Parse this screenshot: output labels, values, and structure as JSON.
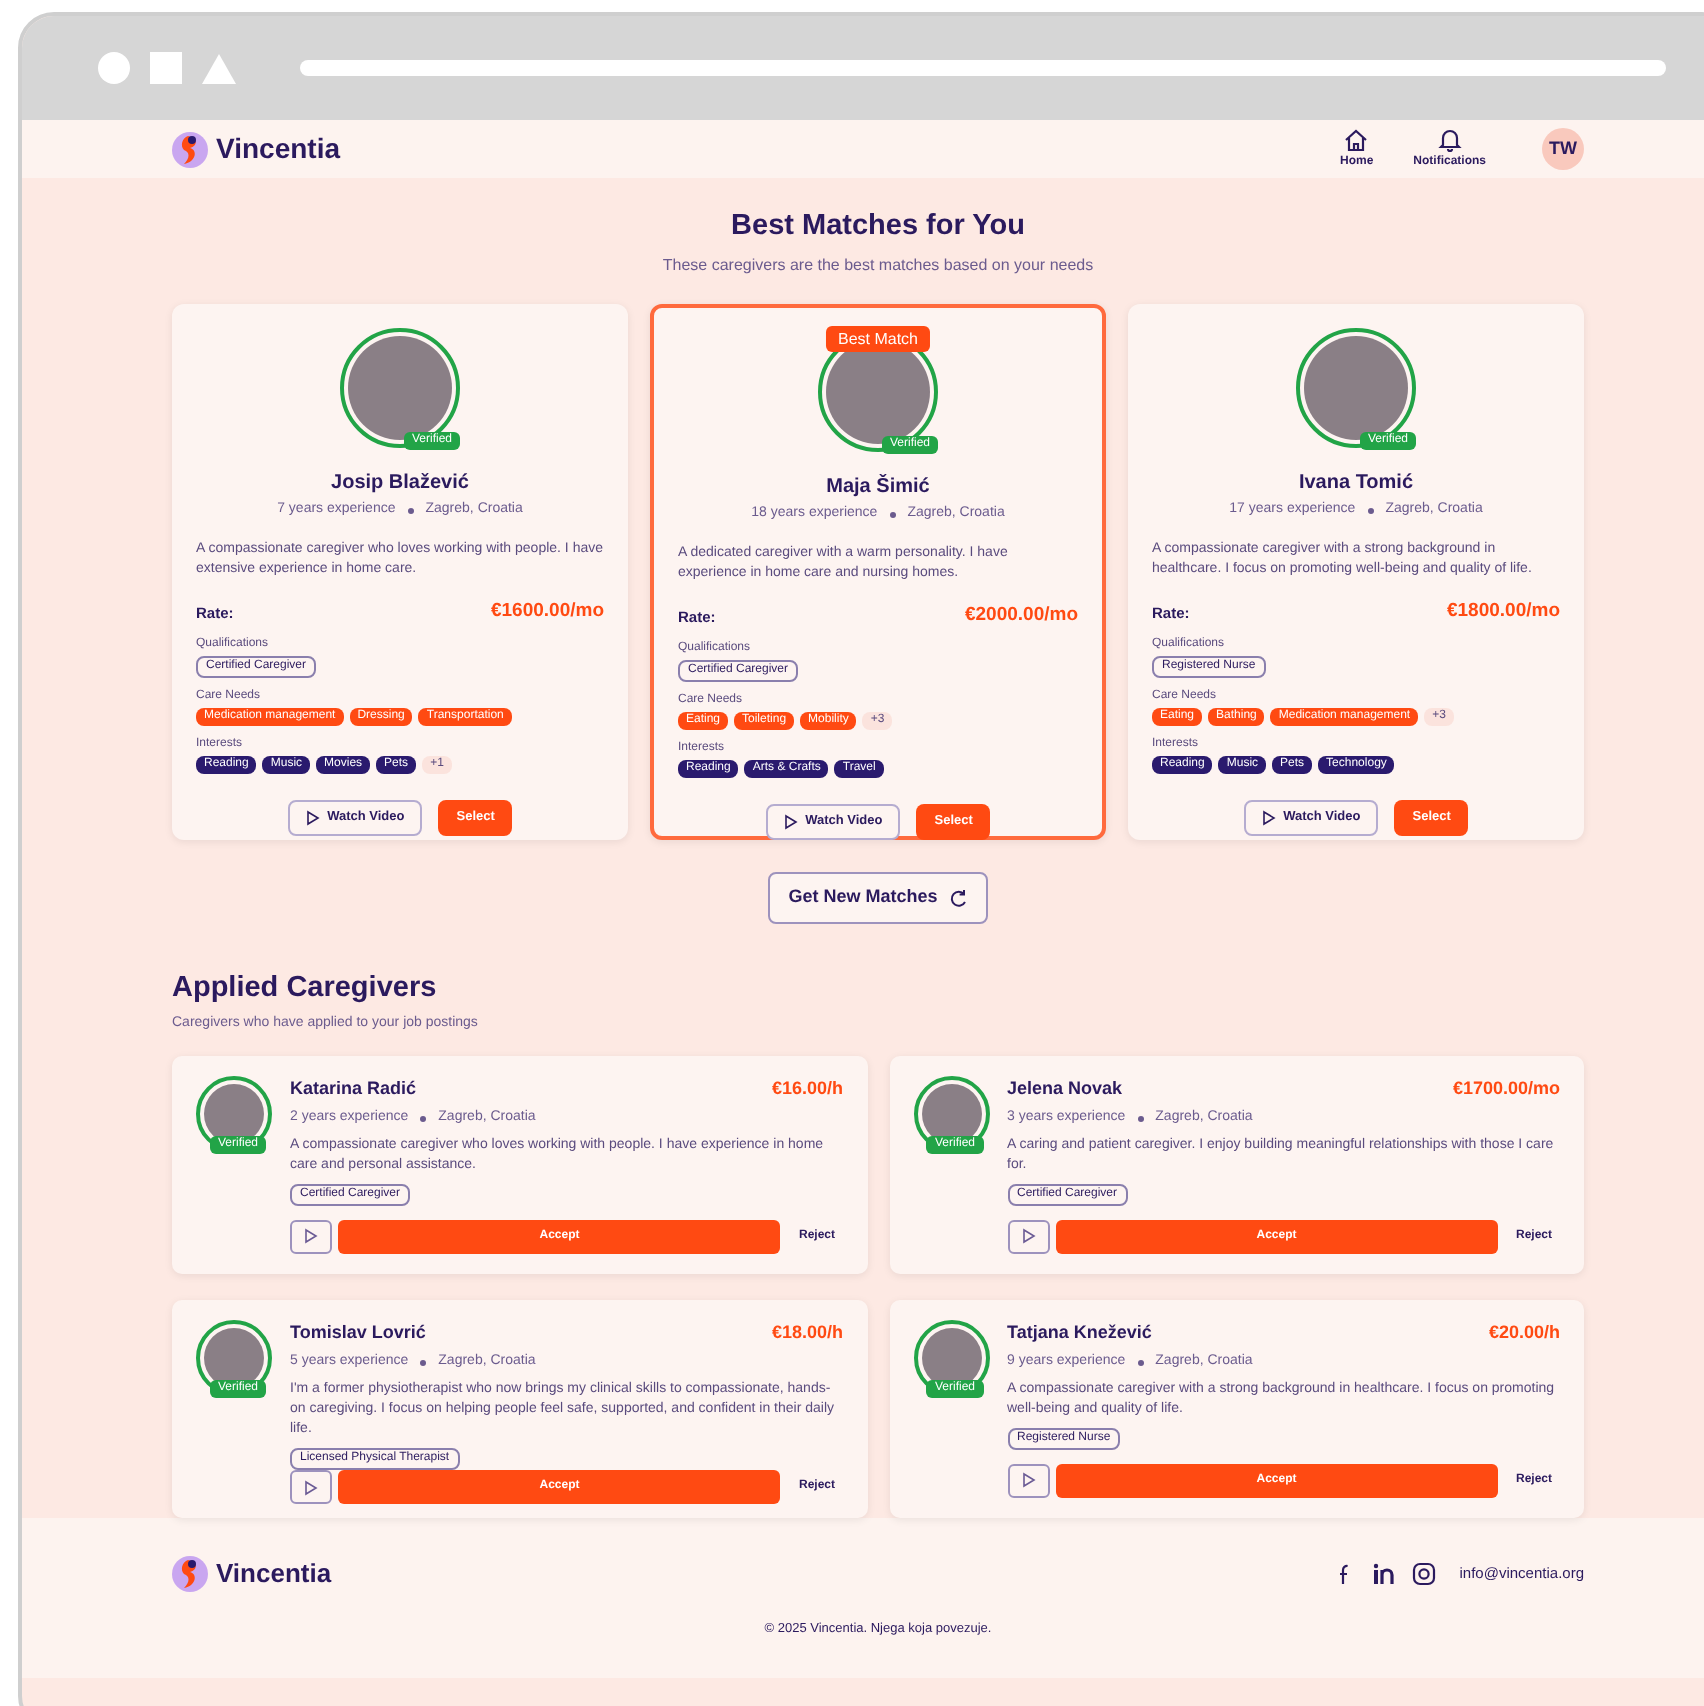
{
  "header": {
    "brand": "Vincentia",
    "nav": [
      {
        "label": "Home"
      },
      {
        "label": "Notifications"
      }
    ],
    "avatar": "TW"
  },
  "matches": {
    "title": "Best Matches for You",
    "subtitle": "These caregivers are the best matches based on your needs",
    "cards": [
      {
        "name": "Josip Blažević",
        "experience": "7 years experience",
        "location": "Zagreb, Croatia",
        "verified": "Verified",
        "featured": false,
        "bio": "A compassionate caregiver who loves working with people. I have extensive experience in home care.",
        "rate_label": "Rate:",
        "rate": "€1600.00/mo",
        "qualifications_label": "Qualifications",
        "qualifications": [
          "Certified Caregiver"
        ],
        "care_needs_label": "Care Needs",
        "care_needs": [
          "Medication management",
          "Dressing",
          "Transportation"
        ],
        "interests_label": "Interests",
        "interests": [
          "Reading",
          "Music",
          "Movies",
          "Pets"
        ],
        "interests_more": "+1",
        "watch": "Watch Video",
        "select": "Select"
      },
      {
        "name": "Maja Šimić",
        "experience": "18 years experience",
        "location": "Zagreb, Croatia",
        "verified": "Verified",
        "featured": true,
        "badge": "Best Match",
        "bio": "A dedicated caregiver with a warm personality. I have experience in home care and nursing homes.",
        "rate_label": "Rate:",
        "rate": "€2000.00/mo",
        "qualifications_label": "Qualifications",
        "qualifications": [
          "Certified Caregiver"
        ],
        "care_needs_label": "Care Needs",
        "care_needs": [
          "Eating",
          "Toileting",
          "Mobility"
        ],
        "care_needs_more": "+3",
        "interests_label": "Interests",
        "interests": [
          "Reading",
          "Arts & Crafts",
          "Travel"
        ],
        "watch": "Watch Video",
        "select": "Select"
      },
      {
        "name": "Ivana Tomić",
        "experience": "17 years experience",
        "location": "Zagreb, Croatia",
        "verified": "Verified",
        "featured": false,
        "bio": "A compassionate caregiver with a strong background in healthcare. I focus on promoting well-being and quality of life.",
        "rate_label": "Rate:",
        "rate": "€1800.00/mo",
        "qualifications_label": "Qualifications",
        "qualifications": [
          "Registered Nurse"
        ],
        "care_needs_label": "Care Needs",
        "care_needs": [
          "Eating",
          "Bathing",
          "Medication management"
        ],
        "care_needs_more": "+3",
        "interests_label": "Interests",
        "interests": [
          "Reading",
          "Music",
          "Pets",
          "Technology"
        ],
        "watch": "Watch Video",
        "select": "Select"
      }
    ],
    "refresh": "Get New Matches"
  },
  "applied": {
    "title": "Applied Caregivers",
    "subtitle": "Caregivers who have applied to your job postings",
    "cards": [
      {
        "name": "Katarina Radić",
        "rate": "€16.00/h",
        "experience": "2 years experience",
        "location": "Zagreb, Croatia",
        "verified": "Verified",
        "bio": "A compassionate caregiver who loves working with people. I have experience in home care and personal assistance.",
        "tags": [
          "Certified Caregiver"
        ],
        "accept": "Accept",
        "reject": "Reject"
      },
      {
        "name": "Jelena Novak",
        "rate": "€1700.00/mo",
        "experience": "3 years experience",
        "location": "Zagreb, Croatia",
        "verified": "Verified",
        "bio": "A caring and patient caregiver. I enjoy building meaningful relationships with those I care for.",
        "tags": [
          "Certified Caregiver"
        ],
        "accept": "Accept",
        "reject": "Reject"
      },
      {
        "name": "Tomislav Lovrić",
        "rate": "€18.00/h",
        "experience": "5 years experience",
        "location": "Zagreb, Croatia",
        "verified": "Verified",
        "bio": "I'm a former physiotherapist who now brings my clinical skills to compassionate, hands-on caregiving. I focus on helping people feel safe, supported, and confident in their daily life.",
        "tags": [
          "Licensed Physical Therapist"
        ],
        "accept": "Accept",
        "reject": "Reject"
      },
      {
        "name": "Tatjana Knežević",
        "rate": "€20.00/h",
        "experience": "9 years experience",
        "location": "Zagreb, Croatia",
        "verified": "Verified",
        "bio": "A compassionate caregiver with a strong background in healthcare. I focus on promoting well-being and quality of life.",
        "tags": [
          "Registered Nurse"
        ],
        "accept": "Accept",
        "reject": "Reject"
      }
    ]
  },
  "footer": {
    "brand": "Vincentia",
    "email": "info@vincentia.org",
    "copyright": "© 2025 Vincentia. Njega koja povezuje."
  }
}
